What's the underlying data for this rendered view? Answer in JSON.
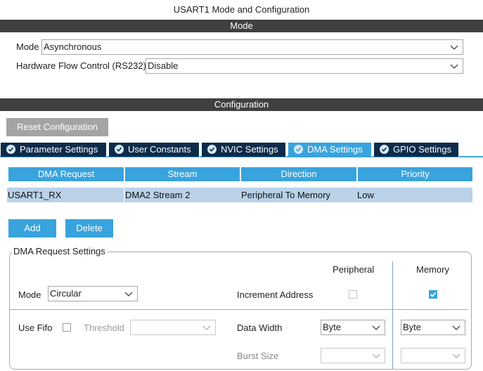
{
  "window": {
    "title": "USART1 Mode and Configuration"
  },
  "mode_section": {
    "header": "Mode",
    "mode_label": "Mode",
    "mode_value": "Asynchronous",
    "flow_label": "Hardware Flow Control (RS232)",
    "flow_value": "Disable"
  },
  "config_section": {
    "header": "Configuration",
    "reset_button": "Reset Configuration",
    "tabs": [
      {
        "label": "Parameter Settings",
        "active": false
      },
      {
        "label": "User Constants",
        "active": false
      },
      {
        "label": "NVIC Settings",
        "active": false
      },
      {
        "label": "DMA Settings",
        "active": true
      },
      {
        "label": "GPIO Settings",
        "active": false
      }
    ]
  },
  "dma_table": {
    "columns": [
      "DMA Request",
      "Stream",
      "Direction",
      "Priority"
    ],
    "rows": [
      [
        "USART1_RX",
        "DMA2 Stream 2",
        "Peripheral To Memory",
        "Low"
      ]
    ]
  },
  "actions": {
    "add": "Add",
    "delete": "Delete"
  },
  "dma_request_settings": {
    "legend": "DMA Request Settings",
    "peripheral_header": "Peripheral",
    "memory_header": "Memory",
    "mode_label": "Mode",
    "mode_value": "Circular",
    "increment_label": "Increment Address",
    "increment_peripheral_checked": false,
    "increment_memory_checked": true,
    "use_fifo_label": "Use Fifo",
    "use_fifo_checked": false,
    "threshold_label": "Threshold",
    "threshold_value": "",
    "data_width_label": "Data Width",
    "data_width_peripheral": "Byte",
    "data_width_memory": "Byte",
    "burst_size_label": "Burst Size",
    "burst_peripheral": "",
    "burst_memory": ""
  },
  "colors": {
    "accent": "#39a3dd",
    "tab_dark": "#0d2b4a",
    "section_bar": "#404040",
    "row_selected": "#b9d2e8"
  }
}
